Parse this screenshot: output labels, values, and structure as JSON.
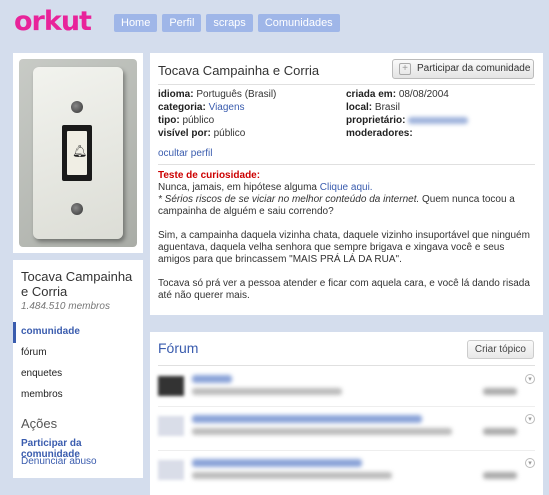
{
  "logo": "orkut",
  "nav": [
    "Home",
    "Perfil",
    "scraps",
    "Comunidades"
  ],
  "community": {
    "name": "Tocava Campainha e Corria",
    "members": "1.484.510 membros",
    "join_label": "Participar da comunidade",
    "info": {
      "idioma_label": "idioma:",
      "idioma": "Português (Brasil)",
      "categoria_label": "categoria:",
      "categoria": "Viagens",
      "tipo_label": "tipo:",
      "tipo": "público",
      "visivel_label": "visível por:",
      "visivel": "público",
      "criada_label": "criada em:",
      "criada": "08/08/2004",
      "local_label": "local:",
      "local": "Brasil",
      "proprietario_label": "proprietário:",
      "moderadores_label": "moderadores:"
    },
    "ocultar": "ocultar perfil",
    "desc": {
      "teste": "Teste de curiosidade:",
      "line1a": "Nunca, jamais, em hipótese alguma ",
      "line1link": "Clique aqui.",
      "line2a": "* Sérios riscos de se viciar no melhor conteúdo da internet.",
      "line2b": " Quem nunca tocou a campainha de alguém e saiu correndo?",
      "para2": "Sim, a campainha daquela vizinha chata, daquele vizinho insuportável que ninguém aguentava, daquela velha senhora que sempre brigava e xingava você e seus amigos para que brincassem \"MAIS PRÁ LÁ DA RUA\".",
      "para3": "Tocava só prá ver a pessoa atender e ficar com aquela cara, e você lá dando risada até não querer mais."
    }
  },
  "menu": [
    "comunidade",
    "fórum",
    "enquetes",
    "membros"
  ],
  "acoes": {
    "title": "Ações",
    "join": "Participar da comunidade",
    "report": "Denunciar abuso"
  },
  "forum": {
    "title": "Fórum",
    "create": "Criar tópico"
  }
}
